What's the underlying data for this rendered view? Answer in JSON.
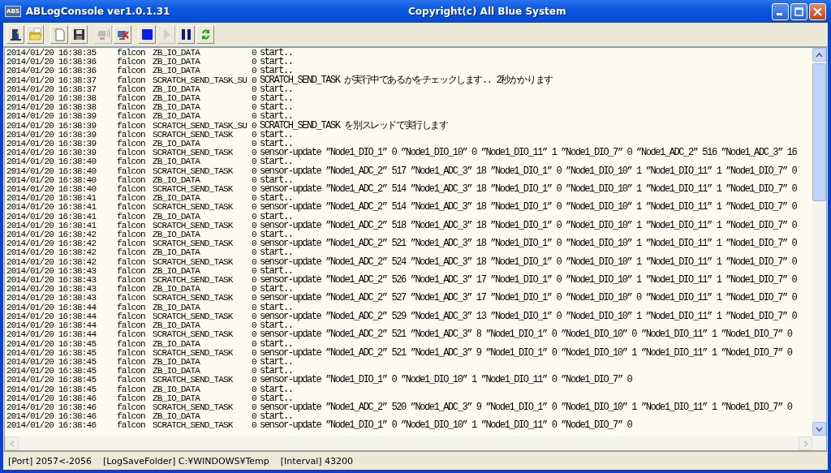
{
  "window": {
    "icon_text": "ABS",
    "title": "ABLogConsole ver1.0.1.31",
    "caption": "Copyright(c) All Blue System"
  },
  "toolbar": {
    "groups": [
      [
        {
          "kind": "exit",
          "disabled": false
        },
        {
          "kind": "open",
          "disabled": false
        }
      ],
      [
        {
          "kind": "new",
          "disabled": false
        },
        {
          "kind": "save",
          "disabled": false
        }
      ],
      [
        {
          "kind": "connect",
          "disabled": true
        },
        {
          "kind": "disconnect",
          "disabled": false
        }
      ],
      [
        {
          "kind": "stop",
          "disabled": false
        },
        {
          "kind": "play",
          "disabled": true
        },
        {
          "kind": "pause",
          "disabled": false
        },
        {
          "kind": "refresh",
          "disabled": false
        }
      ]
    ]
  },
  "log": {
    "rows": [
      {
        "time": "2014/01/20 16:38:35",
        "user": "falcon",
        "task": "ZB_IO_DATA",
        "code": "0",
        "message": "start.."
      },
      {
        "time": "2014/01/20 16:38:36",
        "user": "falcon",
        "task": "ZB_IO_DATA",
        "code": "0",
        "message": "start.."
      },
      {
        "time": "2014/01/20 16:38:36",
        "user": "falcon",
        "task": "ZB_IO_DATA",
        "code": "0",
        "message": "start.."
      },
      {
        "time": "2014/01/20 16:38:37",
        "user": "falcon",
        "task": "SCRATCH_SEND_TASK_SU",
        "code": "0",
        "message": "SCRATCH_SEND_TASK が実行中であるかをチェックします.. 2秒かかります"
      },
      {
        "time": "2014/01/20 16:38:37",
        "user": "falcon",
        "task": "ZB_IO_DATA",
        "code": "0",
        "message": "start.."
      },
      {
        "time": "2014/01/20 16:38:38",
        "user": "falcon",
        "task": "ZB_IO_DATA",
        "code": "0",
        "message": "start.."
      },
      {
        "time": "2014/01/20 16:38:38",
        "user": "falcon",
        "task": "ZB_IO_DATA",
        "code": "0",
        "message": "start.."
      },
      {
        "time": "2014/01/20 16:38:39",
        "user": "falcon",
        "task": "ZB_IO_DATA",
        "code": "0",
        "message": "start.."
      },
      {
        "time": "2014/01/20 16:38:39",
        "user": "falcon",
        "task": "SCRATCH_SEND_TASK_SU",
        "code": "0",
        "message": "SCRATCH_SEND_TASK を別スレッドで実行します"
      },
      {
        "time": "2014/01/20 16:38:39",
        "user": "falcon",
        "task": "SCRATCH_SEND_TASK",
        "code": "0",
        "message": "start.."
      },
      {
        "time": "2014/01/20 16:38:39",
        "user": "falcon",
        "task": "ZB_IO_DATA",
        "code": "0",
        "message": "start.."
      },
      {
        "time": "2014/01/20 16:38:39",
        "user": "falcon",
        "task": "SCRATCH_SEND_TASK",
        "code": "0",
        "message": "sensor-update ”Node1_DIO_1” 0 ”Node1_DIO_10” 0 ”Node1_DIO_11” 1 ”Node1_DIO_7” 0 ”Node1_ADC_2” 516 ”Node1_ADC_3” 16"
      },
      {
        "time": "2014/01/20 16:38:40",
        "user": "falcon",
        "task": "ZB_IO_DATA",
        "code": "0",
        "message": "start.."
      },
      {
        "time": "2014/01/20 16:38:40",
        "user": "falcon",
        "task": "SCRATCH_SEND_TASK",
        "code": "0",
        "message": "sensor-update ”Node1_ADC_2” 517 ”Node1_ADC_3” 18 ”Node1_DIO_1” 0 ”Node1_DIO_10” 1 ”Node1_DIO_11” 1 ”Node1_DIO_7” 0"
      },
      {
        "time": "2014/01/20 16:38:40",
        "user": "falcon",
        "task": "ZB_IO_DATA",
        "code": "0",
        "message": "start.."
      },
      {
        "time": "2014/01/20 16:38:40",
        "user": "falcon",
        "task": "SCRATCH_SEND_TASK",
        "code": "0",
        "message": "sensor-update ”Node1_ADC_2” 514 ”Node1_ADC_3” 18 ”Node1_DIO_1” 0 ”Node1_DIO_10” 1 ”Node1_DIO_11” 1 ”Node1_DIO_7” 0"
      },
      {
        "time": "2014/01/20 16:38:41",
        "user": "falcon",
        "task": "ZB_IO_DATA",
        "code": "0",
        "message": "start.."
      },
      {
        "time": "2014/01/20 16:38:41",
        "user": "falcon",
        "task": "SCRATCH_SEND_TASK",
        "code": "0",
        "message": "sensor-update ”Node1_ADC_2” 514 ”Node1_ADC_3” 18 ”Node1_DIO_1” 0 ”Node1_DIO_10” 1 ”Node1_DIO_11” 1 ”Node1_DIO_7” 0"
      },
      {
        "time": "2014/01/20 16:38:41",
        "user": "falcon",
        "task": "ZB_IO_DATA",
        "code": "0",
        "message": "start.."
      },
      {
        "time": "2014/01/20 16:38:41",
        "user": "falcon",
        "task": "SCRATCH_SEND_TASK",
        "code": "0",
        "message": "sensor-update ”Node1_ADC_2” 518 ”Node1_ADC_3” 18 ”Node1_DIO_1” 0 ”Node1_DIO_10” 1 ”Node1_DIO_11” 1 ”Node1_DIO_7” 0"
      },
      {
        "time": "2014/01/20 16:38:42",
        "user": "falcon",
        "task": "ZB_IO_DATA",
        "code": "0",
        "message": "start.."
      },
      {
        "time": "2014/01/20 16:38:42",
        "user": "falcon",
        "task": "SCRATCH_SEND_TASK",
        "code": "0",
        "message": "sensor-update ”Node1_ADC_2” 521 ”Node1_ADC_3” 18 ”Node1_DIO_1” 0 ”Node1_DIO_10” 1 ”Node1_DIO_11” 1 ”Node1_DIO_7” 0"
      },
      {
        "time": "2014/01/20 16:38:42",
        "user": "falcon",
        "task": "ZB_IO_DATA",
        "code": "0",
        "message": "start.."
      },
      {
        "time": "2014/01/20 16:38:42",
        "user": "falcon",
        "task": "SCRATCH_SEND_TASK",
        "code": "0",
        "message": "sensor-update ”Node1_ADC_2” 524 ”Node1_ADC_3” 18 ”Node1_DIO_1” 0 ”Node1_DIO_10” 1 ”Node1_DIO_11” 1 ”Node1_DIO_7” 0"
      },
      {
        "time": "2014/01/20 16:38:43",
        "user": "falcon",
        "task": "ZB_IO_DATA",
        "code": "0",
        "message": "start.."
      },
      {
        "time": "2014/01/20 16:38:43",
        "user": "falcon",
        "task": "SCRATCH_SEND_TASK",
        "code": "0",
        "message": "sensor-update ”Node1_ADC_2” 526 ”Node1_ADC_3” 17 ”Node1_DIO_1” 0 ”Node1_DIO_10” 1 ”Node1_DIO_11” 1 ”Node1_DIO_7” 0"
      },
      {
        "time": "2014/01/20 16:38:43",
        "user": "falcon",
        "task": "ZB_IO_DATA",
        "code": "0",
        "message": "start.."
      },
      {
        "time": "2014/01/20 16:38:43",
        "user": "falcon",
        "task": "SCRATCH_SEND_TASK",
        "code": "0",
        "message": "sensor-update ”Node1_ADC_2” 527 ”Node1_ADC_3” 17 ”Node1_DIO_1” 0 ”Node1_DIO_10” 0 ”Node1_DIO_11” 1 ”Node1_DIO_7” 0"
      },
      {
        "time": "2014/01/20 16:38:44",
        "user": "falcon",
        "task": "ZB_IO_DATA",
        "code": "0",
        "message": "start.."
      },
      {
        "time": "2014/01/20 16:38:44",
        "user": "falcon",
        "task": "SCRATCH_SEND_TASK",
        "code": "0",
        "message": "sensor-update ”Node1_ADC_2” 529 ”Node1_ADC_3” 13 ”Node1_DIO_1” 0 ”Node1_DIO_10” 1 ”Node1_DIO_11” 1 ”Node1_DIO_7” 0"
      },
      {
        "time": "2014/01/20 16:38:44",
        "user": "falcon",
        "task": "ZB_IO_DATA",
        "code": "0",
        "message": "start.."
      },
      {
        "time": "2014/01/20 16:38:44",
        "user": "falcon",
        "task": "SCRATCH_SEND_TASK",
        "code": "0",
        "message": "sensor-update ”Node1_ADC_2” 521 ”Node1_ADC_3” 8 ”Node1_DIO_1” 0 ”Node1_DIO_10” 0 ”Node1_DIO_11” 1 ”Node1_DIO_7” 0"
      },
      {
        "time": "2014/01/20 16:38:45",
        "user": "falcon",
        "task": "ZB_IO_DATA",
        "code": "0",
        "message": "start.."
      },
      {
        "time": "2014/01/20 16:38:45",
        "user": "falcon",
        "task": "SCRATCH_SEND_TASK",
        "code": "0",
        "message": "sensor-update ”Node1_ADC_2” 521 ”Node1_ADC_3” 9 ”Node1_DIO_1” 0 ”Node1_DIO_10” 1 ”Node1_DIO_11” 1 ”Node1_DIO_7” 0"
      },
      {
        "time": "2014/01/20 16:38:45",
        "user": "falcon",
        "task": "ZB_IO_DATA",
        "code": "0",
        "message": "start.."
      },
      {
        "time": "2014/01/20 16:38:45",
        "user": "falcon",
        "task": "ZB_IO_DATA",
        "code": "0",
        "message": "start.."
      },
      {
        "time": "2014/01/20 16:38:45",
        "user": "falcon",
        "task": "SCRATCH_SEND_TASK",
        "code": "0",
        "message": "sensor-update ”Node1_DIO_1” 0 ”Node1_DIO_10” 1 ”Node1_DIO_11” 0 ”Node1_DIO_7” 0"
      },
      {
        "time": "2014/01/20 16:38:45",
        "user": "falcon",
        "task": "ZB_IO_DATA",
        "code": "0",
        "message": "start.."
      },
      {
        "time": "2014/01/20 16:38:46",
        "user": "falcon",
        "task": "ZB_IO_DATA",
        "code": "0",
        "message": "start.."
      },
      {
        "time": "2014/01/20 16:38:46",
        "user": "falcon",
        "task": "SCRATCH_SEND_TASK",
        "code": "0",
        "message": "sensor-update ”Node1_ADC_2” 520 ”Node1_ADC_3” 9 ”Node1_DIO_1” 0 ”Node1_DIO_10” 1 ”Node1_DIO_11” 1 ”Node1_DIO_7” 0"
      },
      {
        "time": "2014/01/20 16:38:46",
        "user": "falcon",
        "task": "ZB_IO_DATA",
        "code": "0",
        "message": "start.."
      },
      {
        "time": "2014/01/20 16:38:46",
        "user": "falcon",
        "task": "SCRATCH_SEND_TASK",
        "code": "0",
        "message": "sensor-update ”Node1_DIO_1” 0 ”Node1_DIO_10” 1 ”Node1_DIO_11” 0 ”Node1_DIO_7” 0"
      }
    ]
  },
  "status_bar": {
    "items": [
      "[Port] 2057<-2056",
      "[LogSaveFolder] C:¥WINDOWS¥Temp",
      "[Interval] 43200"
    ]
  }
}
